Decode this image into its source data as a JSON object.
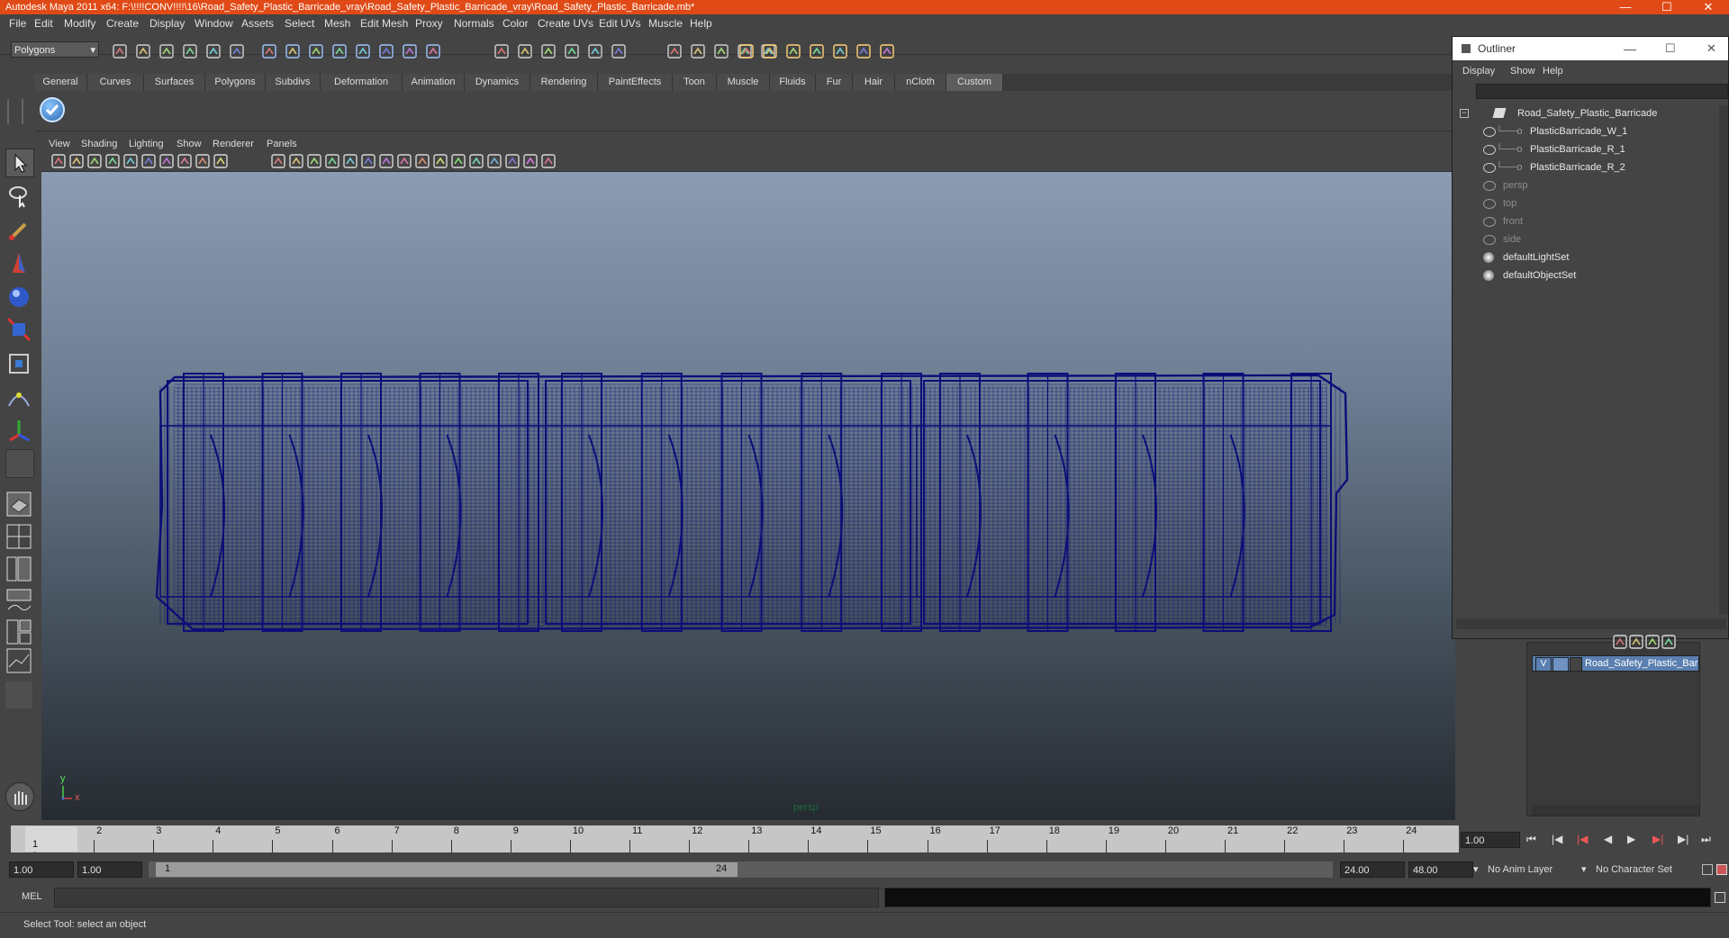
{
  "window": {
    "title": "Autodesk Maya 2011 x64: F:\\!!!!CONV!!!!\\16\\Road_Safety_Plastic_Barricade_vray\\Road_Safety_Plastic_Barricade_vray\\Road_Safety_Plastic_Barricade.mb*",
    "minimize": "—",
    "maximize": "☐",
    "close": "✕"
  },
  "menubar": [
    "File",
    "Edit",
    "Modify",
    "Create",
    "Display",
    "Window",
    "Assets",
    "Select",
    "Mesh",
    "Edit Mesh",
    "Proxy",
    "Normals",
    "Color",
    "Create UVs",
    "Edit UVs",
    "Muscle",
    "Help"
  ],
  "statusline": {
    "mode": "Polygons"
  },
  "shelf": {
    "tabs": [
      "General",
      "Curves",
      "Surfaces",
      "Polygons",
      "Subdivs",
      "Deformation",
      "Animation",
      "Dynamics",
      "Rendering",
      "PaintEffects",
      "Toon",
      "Muscle",
      "Fluids",
      "Fur",
      "Hair",
      "nCloth",
      "Custom"
    ],
    "active": "Custom"
  },
  "viewport": {
    "menus": [
      "View",
      "Shading",
      "Lighting",
      "Show",
      "Renderer",
      "Panels"
    ],
    "camera_label": "persp",
    "axis_y": "y",
    "axis_x": "x",
    "wire_color": "#0c0e78",
    "bg_top": "#8b9cb2",
    "bg_bottom": "#262b31"
  },
  "outliner": {
    "title": "Outliner",
    "menus": [
      "Display",
      "Show",
      "Help"
    ],
    "items": [
      {
        "label": "Road_Safety_Plastic_Barricade",
        "kind": "group"
      },
      {
        "label": "PlasticBarricade_W_1",
        "kind": "mesh"
      },
      {
        "label": "PlasticBarricade_R_1",
        "kind": "mesh"
      },
      {
        "label": "PlasticBarricade_R_2",
        "kind": "mesh"
      },
      {
        "label": "persp",
        "kind": "camera"
      },
      {
        "label": "top",
        "kind": "camera"
      },
      {
        "label": "front",
        "kind": "camera"
      },
      {
        "label": "side",
        "kind": "camera"
      },
      {
        "label": "defaultLightSet",
        "kind": "set"
      },
      {
        "label": "defaultObjectSet",
        "kind": "set"
      }
    ]
  },
  "layers": {
    "visible_flag": "V",
    "layer_name": "Road_Safety_Plastic_Bar"
  },
  "timeline": {
    "ticks": [
      "1",
      "2",
      "3",
      "4",
      "5",
      "6",
      "7",
      "8",
      "9",
      "10",
      "11",
      "12",
      "13",
      "14",
      "15",
      "16",
      "17",
      "18",
      "19",
      "20",
      "21",
      "22",
      "23",
      "24"
    ],
    "current_frame": "1",
    "current_time_field": "1.00"
  },
  "range": {
    "start_time": "1.00",
    "playback_start": "1.00",
    "range_start_label": "1",
    "range_end_label": "24",
    "playback_end": "24.00",
    "end_time": "48.00",
    "anim_layer": "No Anim Layer",
    "character_set": "No Character Set"
  },
  "command": {
    "label": "MEL"
  },
  "help": {
    "text": "Select Tool: select an object"
  }
}
